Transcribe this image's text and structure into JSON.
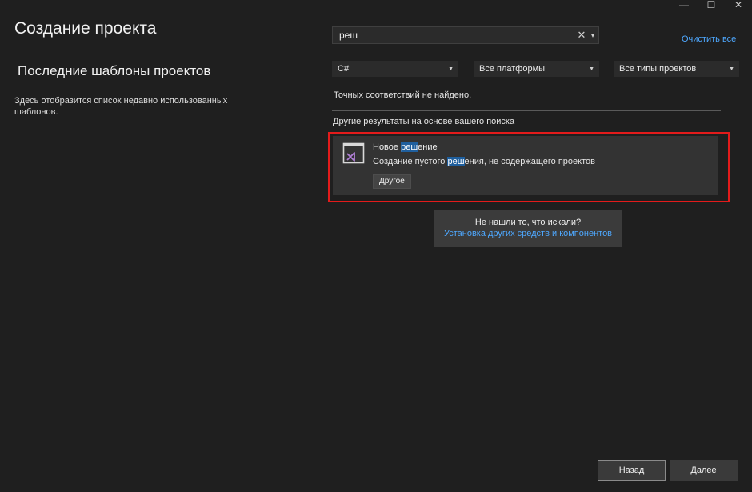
{
  "window": {
    "controls": [
      "—",
      "☐",
      "✕"
    ]
  },
  "page": {
    "title": "Создание проекта"
  },
  "recent": {
    "title": "Последние шаблоны проектов",
    "description": "Здесь отобразится список недавно использованных шаблонов."
  },
  "search": {
    "value": "реш",
    "clear_glyph": "✕",
    "dropdown_glyph": "▾"
  },
  "clear_all_label": "Очистить все",
  "filters": {
    "language": "C#",
    "platform": "Все платформы",
    "project_type": "Все типы проектов"
  },
  "results": {
    "no_exact": "Точных соответствий не найдено.",
    "other_header": "Другие результаты на основе вашего поиска",
    "items": [
      {
        "name_before": "Новое ",
        "name_match": "реш",
        "name_after": "ение",
        "desc_before": "Создание пустого ",
        "desc_match": "реш",
        "desc_after": "ения, не содержащего проектов",
        "tag": "Другое",
        "icon": "vs-solution-icon"
      }
    ]
  },
  "help": {
    "question": "Не нашли то, что искали?",
    "link": "Установка других средств и компонентов"
  },
  "footer": {
    "back": "Назад",
    "next": "Далее"
  },
  "colors": {
    "background": "#1f1f1f",
    "link": "#4ea8ff",
    "highlight": "#1f5f9e",
    "focus_border": "#e31b1b",
    "vs_purple": "#b180d7"
  }
}
